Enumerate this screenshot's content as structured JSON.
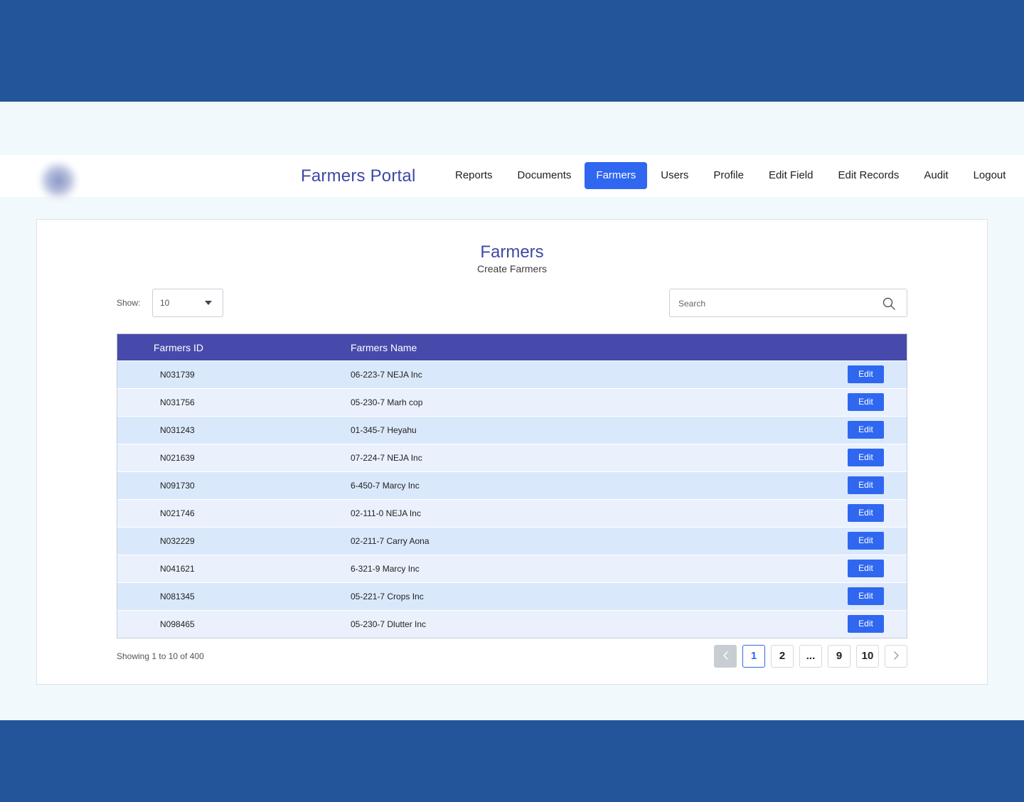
{
  "app": {
    "title": "Farmers Portal"
  },
  "nav": {
    "items": [
      {
        "label": "Reports"
      },
      {
        "label": "Documents"
      },
      {
        "label": "Farmers"
      },
      {
        "label": "Users"
      },
      {
        "label": "Profile"
      },
      {
        "label": "Edit Field"
      },
      {
        "label": "Edit Records"
      },
      {
        "label": "Audit"
      },
      {
        "label": "Logout"
      }
    ],
    "active": "Farmers"
  },
  "page": {
    "title": "Farmers",
    "subtitle": "Create Farmers"
  },
  "show": {
    "label": "Show:",
    "value": "10"
  },
  "search": {
    "placeholder": "Search",
    "value": ""
  },
  "table": {
    "columns": [
      "Farmers ID",
      "Farmers Name"
    ],
    "edit_label": "Edit",
    "rows": [
      {
        "id": "N031739",
        "name": "06-223-7 NEJA Inc"
      },
      {
        "id": "N031756",
        "name": "05-230-7 Marh cop"
      },
      {
        "id": "N031243",
        "name": "01-345-7 Heyahu"
      },
      {
        "id": "N021639",
        "name": "07-224-7 NEJA Inc"
      },
      {
        "id": "N091730",
        "name": "6-450-7 Marcy Inc"
      },
      {
        "id": "N021746",
        "name": "02-111-0 NEJA Inc"
      },
      {
        "id": "N032229",
        "name": "02-211-7 Carry Aona"
      },
      {
        "id": "N041621",
        "name": "6-321-9 Marcy Inc"
      },
      {
        "id": "N081345",
        "name": "05-221-7 Crops Inc"
      },
      {
        "id": "N098465",
        "name": "05-230-7 Dlutter Inc"
      }
    ]
  },
  "pagination": {
    "summary": "Showing 1 to 10 of 400",
    "pages": [
      "1",
      "2",
      "...",
      "9",
      "10"
    ],
    "current": "1"
  },
  "colors": {
    "frame": "#23559B",
    "background": "#F1F9FD",
    "brand": "#3D48A8",
    "accent": "#2F67F0",
    "table_header": "#4749AB",
    "row_odd": "#DAE8FB",
    "row_even": "#EAF1FD"
  }
}
